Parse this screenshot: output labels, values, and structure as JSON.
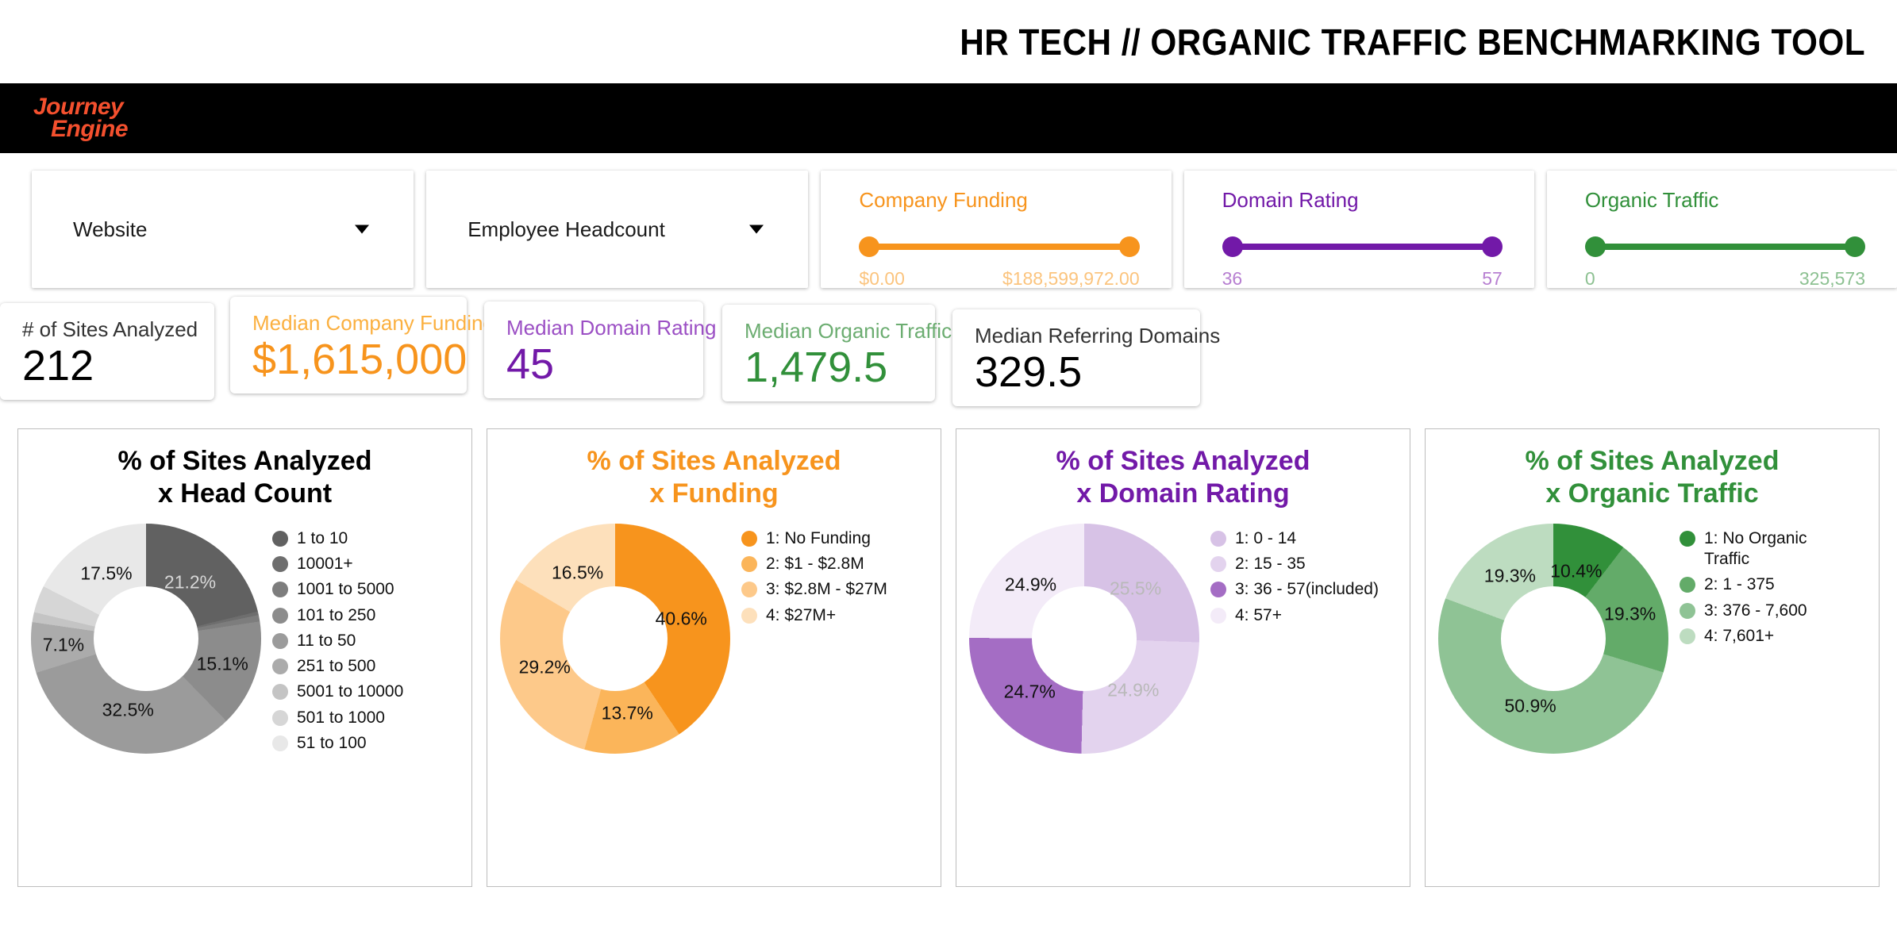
{
  "header": {
    "title": "HR TECH // ORGANIC TRAFFIC BENCHMARKING TOOL"
  },
  "brand": {
    "line1": "Journey",
    "line2": "Engine",
    "color": "#f4502e",
    "band_color": "#000000"
  },
  "filters": {
    "dropdowns": [
      {
        "label": "Website",
        "caret_icon": "chevron-down-icon"
      },
      {
        "label": "Employee Headcount",
        "caret_icon": "chevron-down-icon"
      }
    ],
    "sliders": [
      {
        "title": "Company Funding",
        "min": "$0.00",
        "max": "$188,599,972.00",
        "color": "#f7941d",
        "value_color": "#fbc47e"
      },
      {
        "title": "Domain Rating",
        "min": "36",
        "max": "57",
        "color": "#7219a8",
        "value_color": "#b77fd1"
      },
      {
        "title": "Organic Traffic",
        "min": "0",
        "max": "325,573",
        "color": "#31903a",
        "value_color": "#8dc192"
      }
    ]
  },
  "kpis": [
    {
      "label": "# of Sites Analyzed",
      "value": "212",
      "color": "#000000",
      "label_color": "#333333"
    },
    {
      "label": "Median Company Funding",
      "value": "$1,615,000",
      "color": "#f7941d",
      "label_color": "#fbb040"
    },
    {
      "label": "Median Domain Rating",
      "value": "45",
      "color": "#7219a8",
      "label_color": "#9b4fc4"
    },
    {
      "label": "Median Organic Traffic",
      "value": "1,479.5",
      "color": "#31903a",
      "label_color": "#6cad71"
    },
    {
      "label": "Median Referring Domains",
      "value": "329.5",
      "color": "#000000",
      "label_color": "#333333"
    }
  ],
  "chart_data": [
    {
      "type": "pie",
      "title": "% of Sites Analyzed\nx Head Count",
      "title_line1": "% of Sites Analyzed",
      "title_line2": "x Head Count",
      "title_color": "#000000",
      "categories": [
        "1 to 10",
        "10001+",
        "1001 to 5000",
        "101 to 250",
        "11 to 50",
        "251 to 500",
        "5001 to 10000",
        "501 to 1000",
        "51 to 100"
      ],
      "values": [
        21.2,
        0.5,
        0.9,
        15.1,
        32.5,
        7.1,
        1.4,
        3.8,
        17.5
      ],
      "labels": [
        "21.2%",
        "",
        "",
        "15.1%",
        "32.5%",
        "7.1%",
        "",
        "",
        "17.5%"
      ],
      "colors": [
        "#616161",
        "#6e6e6e",
        "#7d7d7d",
        "#8c8c8c",
        "#9b9b9b",
        "#ababab",
        "#c4c4c4",
        "#d6d6d6",
        "#e8e8e8"
      ],
      "legend_position": "right"
    },
    {
      "type": "pie",
      "title": "% of Sites Analyzed\nx Funding",
      "title_line1": "% of Sites Analyzed",
      "title_line2": "x Funding",
      "title_color": "#f7941d",
      "categories": [
        "1: No Funding",
        "2: $1 - $2.8M",
        "3: $2.8M - $27M",
        "4: $27M+"
      ],
      "values": [
        40.6,
        13.7,
        29.2,
        16.5
      ],
      "labels": [
        "40.6%",
        "13.7%",
        "29.2%",
        "16.5%"
      ],
      "colors": [
        "#f7941d",
        "#fbb55a",
        "#fdc98a",
        "#fde0bb"
      ],
      "legend_position": "right"
    },
    {
      "type": "pie",
      "title": "% of Sites Analyzed\nx Domain Rating",
      "title_line1": "% of Sites Analyzed",
      "title_line2": "x Domain Rating",
      "title_color": "#7219a8",
      "categories": [
        "1: 0 - 14",
        "2: 15 - 35",
        "3: 36 - 57(included)",
        "4: 57+"
      ],
      "values": [
        25.5,
        24.9,
        24.7,
        24.9
      ],
      "labels": [
        "25.5%",
        "24.9%",
        "24.7%",
        "24.9%"
      ],
      "colors": [
        "#d9c4e8",
        "#e6d7f0",
        "#a濃",
        "#f4ecf9"
      ],
      "slice_colors": [
        "#d7c2e6",
        "#e3d3ee",
        "#a46dc4",
        "#f3ebf8"
      ],
      "legend_position": "right"
    },
    {
      "type": "pie",
      "title": "% of Sites Analyzed\nx Organic Traffic",
      "title_line1": "% of Sites Analyzed",
      "title_line2": "x Organic Traffic",
      "title_color": "#31903a",
      "categories": [
        "1: No Organic Traffic",
        "2: 1 - 375",
        "3: 376 - 7,600",
        "4: 7,601+"
      ],
      "values": [
        10.4,
        19.3,
        50.9,
        19.3
      ],
      "labels": [
        "10.4%",
        "19.3%",
        "50.9%",
        "19.3%"
      ],
      "colors": [
        "#31903a",
        "#63ab69",
        "#8fc395",
        "#bddcc0"
      ],
      "legend_position": "right"
    }
  ]
}
